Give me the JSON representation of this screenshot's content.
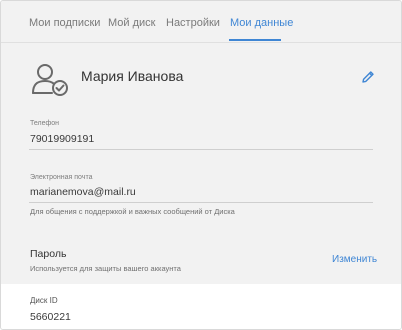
{
  "tabs": [
    {
      "label": "Мои подписки",
      "active": false
    },
    {
      "label": "Мой диск",
      "active": false
    },
    {
      "label": "Настройки",
      "active": false
    },
    {
      "label": "Мои данные",
      "active": true
    }
  ],
  "profile": {
    "name": "Мария Иванова",
    "avatar_icon": "user-check-icon",
    "edit_icon": "pencil-icon"
  },
  "phone": {
    "label": "Телефон",
    "value": "79019909191"
  },
  "email": {
    "label": "Электронная почта",
    "value": "marianemova@mail.ru",
    "hint": "Для общения с поддержкой и важных сообщений от Диска"
  },
  "password": {
    "title": "Пароль",
    "hint": "Используется для защиты вашего аккаунта",
    "change_label": "Изменить"
  },
  "disk": {
    "label": "Диск ID",
    "value": "5660221"
  },
  "colors": {
    "accent": "#3f86d4",
    "background": "#f2f2f2",
    "panel": "#ffffff"
  }
}
